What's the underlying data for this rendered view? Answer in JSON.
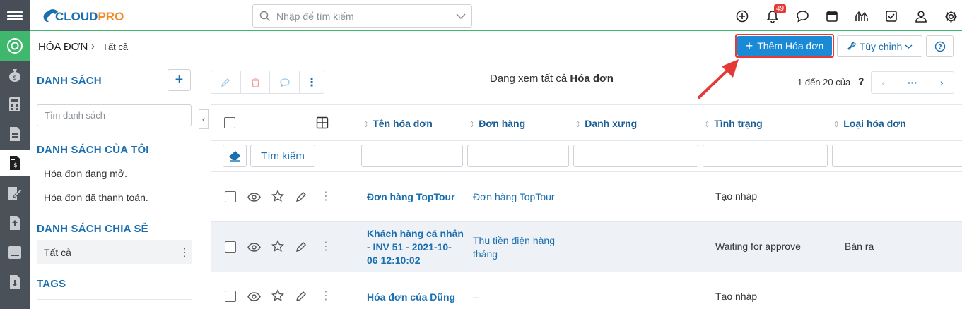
{
  "header": {
    "logo_text": "CLOUDPRO",
    "search_placeholder": "Nhập để tìm kiếm",
    "notification_count": "49"
  },
  "breadcrumb": {
    "module": "HÓA ĐƠN",
    "separator": "›",
    "current": "Tất cả"
  },
  "actions": {
    "add_label": "Thêm Hóa đơn",
    "customize_label": "Tùy chỉnh"
  },
  "sidebar": {
    "lists_title": "DANH SÁCH",
    "search_placeholder": "Tìm danh sách",
    "my_lists_title": "DANH SÁCH CỦA TÔI",
    "my_lists": [
      "Hóa đơn đang mở.",
      "Hóa đơn đã thanh toán."
    ],
    "shared_title": "DANH SÁCH CHIA SẺ",
    "shared_items": [
      "Tất cả"
    ],
    "tags_title": "TAGS"
  },
  "list_view": {
    "viewing_prefix": "Đang xem tất cả",
    "viewing_module": "Hóa đơn",
    "pager_text": "1 đến 20 của",
    "pager_unknown": "?",
    "search_button": "Tìm kiếm",
    "columns": [
      "Tên hóa đơn",
      "Đơn hàng",
      "Danh xưng",
      "Tình trạng",
      "Loại hóa đơn"
    ],
    "rows": [
      {
        "name": [
          "Đơn hàng TopTour"
        ],
        "order": [
          "Đơn hàng TopTour"
        ],
        "title": "",
        "status": "Tạo nháp",
        "type": ""
      },
      {
        "name": [
          "Khách hàng cá nhân",
          "- INV 51 - 2021-10-",
          "06 12:10:02"
        ],
        "order": [
          "Thu tiền điện hàng",
          "tháng"
        ],
        "title": "",
        "status": "Waiting for approve",
        "type": "Bán ra"
      },
      {
        "name": [
          "Hóa đơn của Dũng"
        ],
        "order": [
          "--"
        ],
        "title": "",
        "status": "Tạo nháp",
        "type": ""
      }
    ]
  }
}
